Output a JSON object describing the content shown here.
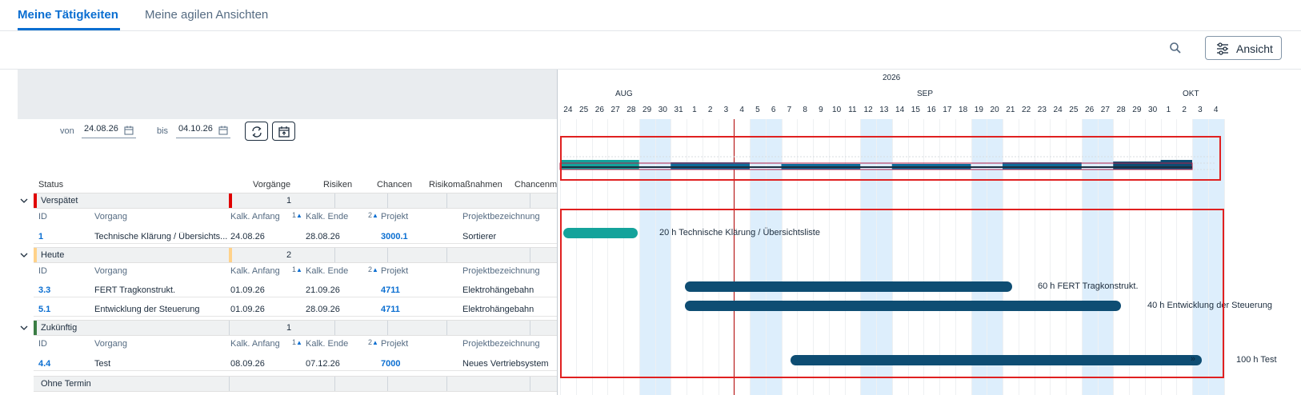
{
  "tabs": [
    {
      "label": "Meine Tätigkeiten",
      "active": true
    },
    {
      "label": "Meine agilen Ansichten",
      "active": false
    }
  ],
  "toolbar": {
    "search_icon": "search-icon",
    "view_label": "Ansicht",
    "view_icon": "sliders-icon"
  },
  "timeline": {
    "year": "2026",
    "months": [
      "AUG",
      "SEP",
      "OKT"
    ],
    "days": [
      "24",
      "25",
      "26",
      "27",
      "28",
      "29",
      "30",
      "31",
      "1",
      "2",
      "3",
      "4",
      "5",
      "6",
      "7",
      "8",
      "9",
      "10",
      "11",
      "12",
      "13",
      "14",
      "15",
      "16",
      "17",
      "18",
      "19",
      "20",
      "21",
      "22",
      "23",
      "24",
      "25",
      "26",
      "27",
      "28",
      "29",
      "30",
      "1",
      "2",
      "3",
      "4"
    ]
  },
  "filter": {
    "from_label": "von",
    "from_value": "24.08.26",
    "to_label": "bis",
    "to_value": "04.10.26"
  },
  "columns": [
    "Status",
    "Vorgänge",
    "Risiken",
    "Chancen",
    "Risikomaßnahmen",
    "Chancenm"
  ],
  "sub_headers": {
    "id": "ID",
    "vorgang": "Vorgang",
    "anfang": "Kalk. Anfang",
    "ende": "Kalk. Ende",
    "projekt": "Projekt",
    "bezeichnung": "Projektbezeichnung",
    "sort1": "1",
    "sort2": "2"
  },
  "groups": [
    {
      "label": "Verspätet",
      "count": "1",
      "color": "#e00000",
      "rows": [
        {
          "id": "1",
          "vorgang": "Technische Klärung / Übersichts...",
          "anfang": "24.08.26",
          "ende": "28.08.26",
          "projekt": "3000.1",
          "bezeichnung": "Sortierer"
        }
      ]
    },
    {
      "label": "Heute",
      "count": "2",
      "color": "#ffd28a",
      "rows": [
        {
          "id": "3.3",
          "vorgang": "FERT Tragkonstrukt.",
          "anfang": "01.09.26",
          "ende": "21.09.26",
          "projekt": "4711",
          "bezeichnung": "Elektrohängebahn"
        },
        {
          "id": "5.1",
          "vorgang": "Entwicklung der Steuerung",
          "anfang": "01.09.26",
          "ende": "28.09.26",
          "projekt": "4711",
          "bezeichnung": "Elektrohängebahn"
        }
      ]
    },
    {
      "label": "Zukünftig",
      "count": "1",
      "color": "#3a7d44",
      "rows": [
        {
          "id": "4.4",
          "vorgang": "Test",
          "anfang": "08.09.26",
          "ende": "07.12.26",
          "projekt": "7000",
          "bezeichnung": "Neues Vertriebsystem"
        }
      ]
    },
    {
      "label": "Ohne Termin",
      "count": "",
      "color": "#eff1f2",
      "rows": []
    }
  ],
  "bars": [
    {
      "label": "20 h  Technische Klärung / Übersichtsliste",
      "color": "#14a39b"
    },
    {
      "label": "60 h  FERT Tragkonstrukt.",
      "color": "#0e4d73"
    },
    {
      "label": "40 h  Entwicklung der Steuerung",
      "color": "#0e4d73"
    },
    {
      "label": "100 h  Test",
      "color": "#0e4d73"
    }
  ]
}
